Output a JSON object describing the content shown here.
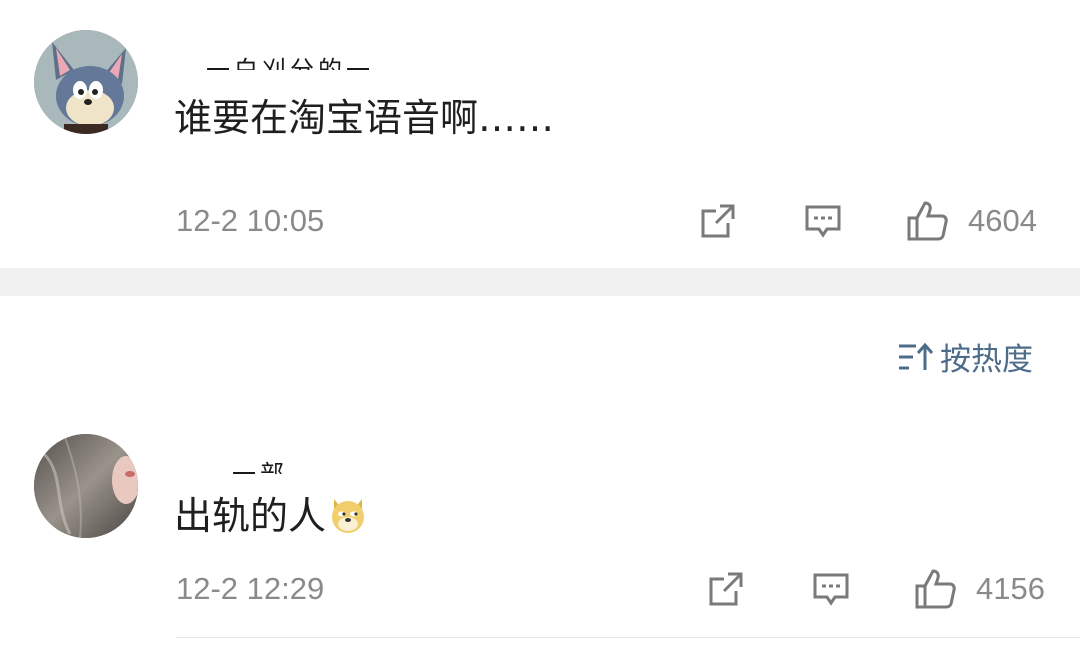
{
  "comments": [
    {
      "username": "一白刈分的一",
      "text": "谁要在淘宝语音啊……",
      "time": "12-2 10:05",
      "likes": "4604"
    },
    {
      "username": "一部",
      "text": "出轨的人",
      "emoji": "doge-emoji",
      "time": "12-2 12:29",
      "likes": "4156"
    }
  ],
  "sort": {
    "label": "按热度",
    "icon": "sort-icon"
  },
  "icons": {
    "share": "share-icon",
    "comment": "comment-icon",
    "like": "thumbs-up-icon"
  },
  "colors": {
    "link_blue": "#4d6c8a",
    "meta_gray": "#8a8a8a",
    "divider_gray": "#f0f0f0"
  }
}
